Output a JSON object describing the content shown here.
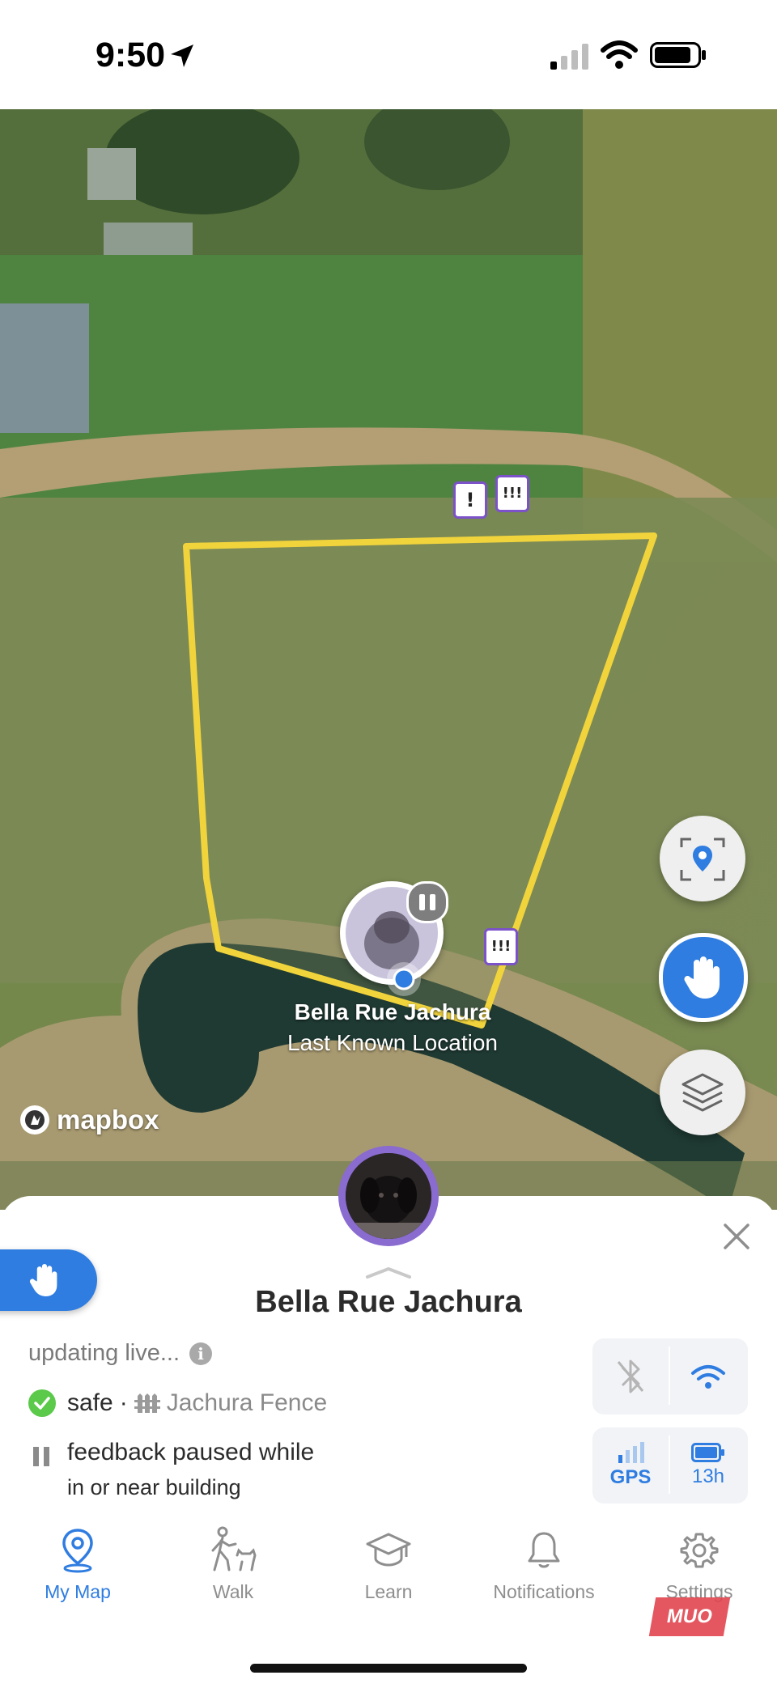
{
  "status_bar": {
    "time": "9:50"
  },
  "map": {
    "attribution": "mapbox",
    "pet_label_name": "Bella Rue Jachura",
    "pet_label_status": "Last Known Location",
    "alert_pin_1": "!",
    "alert_pin_2": "!!!",
    "alert_pin_3": "!!!",
    "buttons": [
      "focus-location",
      "stop-pet",
      "map-layers"
    ]
  },
  "sheet": {
    "pet_name": "Bella Rue Jachura",
    "updating": "updating live...",
    "info_glyph": "i",
    "safe_status": "safe",
    "dot": "·",
    "fence_name": "Jachura Fence",
    "paused_line1": "feedback paused while",
    "paused_line2": "in or near building",
    "gps_label": "GPS",
    "battery_label": "13h"
  },
  "tabs": [
    {
      "label": "My Map",
      "icon": "map-pin-icon",
      "active": true
    },
    {
      "label": "Walk",
      "icon": "walk-icon",
      "active": false
    },
    {
      "label": "Learn",
      "icon": "graduation-cap-icon",
      "active": false
    },
    {
      "label": "Notifications",
      "icon": "bell-icon",
      "active": false
    },
    {
      "label": "Settings",
      "icon": "gear-icon",
      "active": false
    }
  ],
  "watermark": "MUO",
  "colors": {
    "accent": "#2f7de1",
    "fence": "#f1d43c",
    "alert_border": "#7b52c8",
    "safe": "#5bc94a"
  }
}
